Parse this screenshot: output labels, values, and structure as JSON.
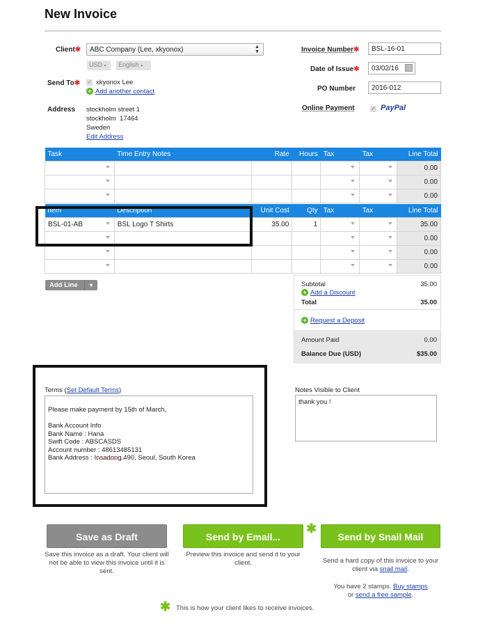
{
  "title": "New Invoice",
  "client": {
    "label": "Client",
    "value": "ABC Company (Lee, xkyonox)",
    "currency": "USD",
    "language": "English"
  },
  "send_to": {
    "label": "Send To",
    "contact": "xkyonox Lee",
    "add_contact": "Add another contact"
  },
  "address": {
    "label": "Address",
    "line1": "stockholm street 1",
    "line2": "stockholm  17464",
    "line3": "Sweden",
    "edit": "Edit Address"
  },
  "right_fields": {
    "invoice_number_label": "Invoice Number",
    "invoice_number": "BSL-16-01",
    "date_label": "Date of Issue",
    "date": "03/02/16",
    "po_label": "PO Number",
    "po": "2016-012",
    "online_payment_label": "Online Payment",
    "paypal": "PayPal"
  },
  "task_table": {
    "headers": [
      "Task",
      "Time Entry Notes",
      "Rate",
      "Hours",
      "Tax",
      "Tax",
      "Line Total"
    ],
    "rows": [
      {
        "total": "0.00"
      },
      {
        "total": "0.00"
      },
      {
        "total": "0.00"
      }
    ]
  },
  "item_table": {
    "headers": [
      "Item",
      "Description",
      "Unit Cost",
      "Qty",
      "Tax",
      "Tax",
      "Line Total"
    ],
    "rows": [
      {
        "item": "BSL-01-AB",
        "description": "BSL Logo T Shirts",
        "unit_cost": "35.00",
        "qty": "1",
        "total": "35.00"
      },
      {
        "item": "",
        "description": "",
        "unit_cost": "",
        "qty": "",
        "total": "0.00"
      },
      {
        "item": "",
        "description": "",
        "unit_cost": "",
        "qty": "",
        "total": "0.00"
      },
      {
        "item": "",
        "description": "",
        "unit_cost": "",
        "qty": "",
        "total": "0.00"
      }
    ]
  },
  "add_line": "Add Line",
  "totals": {
    "subtotal_label": "Subtotal",
    "subtotal": "35.00",
    "add_discount": "Add a Discount",
    "total_label": "Total",
    "total": "35.00",
    "request_deposit": "Request a Deposit",
    "amount_paid_label": "Amount Paid",
    "amount_paid": "0.00",
    "balance_label": "Balance Due (USD)",
    "balance": "$35.00"
  },
  "terms": {
    "label": "Terms (",
    "link": "Set Default Terms",
    "close": ")",
    "text": "Please make payment by 15th of March,\n\nBank Account Info\nBank Name : Hana\nSwift Code : ABSCASDS\nAccount number : 48613485131\nBank Address : Insadong 490, Seoul, South Korea"
  },
  "notes": {
    "label": "Notes Visible to Client",
    "text": "thank you !"
  },
  "actions": {
    "draft": "Save as Draft",
    "draft_caption": "Save this invoice as a draft. Your client will not be able to view this invoice until it is sent.",
    "email": "Send by Email...",
    "email_caption": "Preview this invoice and send it to your client.",
    "snail": "Send by Snail Mail",
    "snail_caption_1": "Send a hard copy of this invoice to your client via",
    "snail_link": "snail mail",
    "stamps_1": "You have 2 stamps.",
    "buy_stamps": "Buy stamps",
    "stamps_or": "or",
    "free_sample": "send a free sample",
    "footer_note": "This is how your client likes to receive invoices."
  },
  "colors": {
    "header_blue": "#1a86df",
    "green": "#7ac21b",
    "gray_button": "#8c8c8c"
  }
}
